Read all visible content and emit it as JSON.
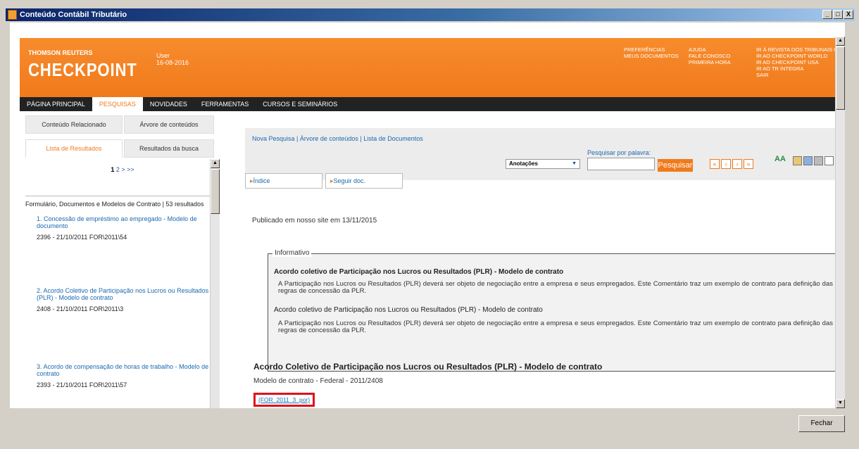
{
  "window": {
    "title": "Conteúdo Contábil Tributário",
    "controls": [
      "_",
      "□",
      "X"
    ]
  },
  "header": {
    "brand_top": "THOMSON REUTERS",
    "brand": "CHECKPOINT",
    "user_label": "User",
    "user_date": "16-08-2016",
    "links_a": [
      "PREFERÊNCIAS",
      "MEUS DOCUMENTOS"
    ],
    "links_b": [
      "AJUDA",
      "FALE CONOSCO",
      "PRIMEIRA HORA"
    ],
    "links_c": [
      "IR À REVISTA DOS TRIBUNAIS ONL",
      "IR AO CHECKPOINT WORLD",
      "IR AO CHECKPOINT USA",
      "IR AO TR INTEGRA",
      "SAIR"
    ]
  },
  "nav": [
    "PÁGINA PRINCIPAL",
    "PESQUISAS",
    "NOVIDADES",
    "FERRAMENTAS",
    "CURSOS E SEMINÁRIOS"
  ],
  "left_tabs": [
    "Conteúdo Relacionado",
    "Árvore de conteúdos",
    "Lista de Resultados",
    "Resultados da busca"
  ],
  "pager": {
    "current": "1",
    "rest": "2 > >>"
  },
  "results_header": "Formulário, Documentos e Modelos de Contrato | 53 resultados",
  "results": [
    {
      "title": "1. Concessão de empréstimo ao empregado - Modelo de documento",
      "meta": "2396 - 21/10/2011 FOR\\2011\\54"
    },
    {
      "title": "2. Acordo Coletivo de Participação nos Lucros ou Resultados (PLR) - Modelo de contrato",
      "meta": "2408 - 21/10/2011 FOR\\2011\\3"
    },
    {
      "title": "3. Acordo de compensação de horas de trabalho - Modelo de contrato",
      "meta": "2393 - 21/10/2011 FOR\\2011\\57"
    }
  ],
  "toolbar": {
    "links": "Nova Pesquisa | Árvore de conteúdos | Lista de Documentos",
    "annotations": "Anotações",
    "search_label": "Pesquisar por palavra:",
    "search_value": "",
    "search_button": "Pesquisar",
    "nav": [
      "«",
      "‹",
      "›",
      "»"
    ],
    "font_icon": "AA"
  },
  "doc_buttons": [
    "Índice",
    "Seguir doc."
  ],
  "published": "Publicado em nosso site em 13/11/2015",
  "informativo": {
    "label": "Informativo",
    "title": "Acordo coletivo de Participação nos Lucros ou Resultados (PLR) - Modelo de contrato",
    "p1": "A Participação nos Lucros ou Resultados (PLR) deverá ser objeto de negociação entre a empresa e seus empregados. Este Comentário traz um exemplo de contrato para definição das regras de concessão da PLR.",
    "sub": "Acordo coletivo de Participação nos Lucros ou Resultados (PLR) - Modelo de contrato",
    "p2": "A Participação nos Lucros ou Resultados (PLR) deverá ser objeto de negociação entre a empresa e seus empregados. Este Comentário traz um exemplo de contrato para definição das regras de concessão da PLR."
  },
  "document": {
    "title": "Acordo Coletivo de Participação nos Lucros ou Resultados (PLR) - Modelo de contrato",
    "subtitle": "Modelo de contrato - Federal - 2011/2408",
    "link": "(FOR_2011_3_por)"
  },
  "footer": {
    "close": "Fechar"
  },
  "colors": {
    "brand_orange": "#f07a1c",
    "highlight_red": "#e0101a",
    "link_blue": "#1a69b0"
  }
}
